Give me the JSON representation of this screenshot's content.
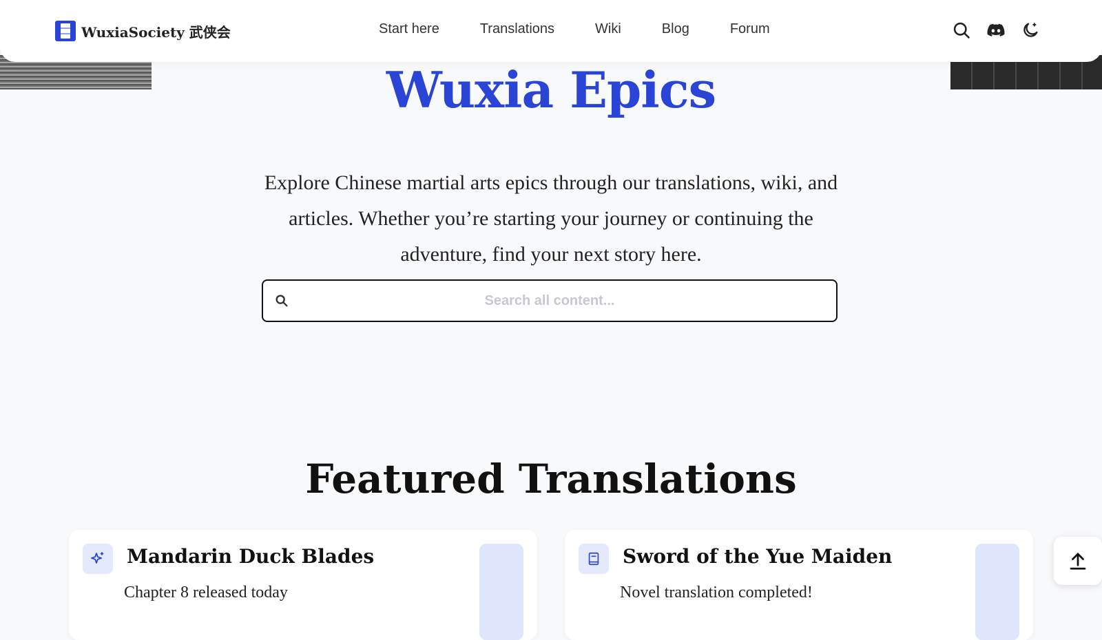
{
  "header": {
    "logo_text": "WuxiaSociety 武侠会",
    "nav": [
      "Start here",
      "Translations",
      "Wiki",
      "Blog",
      "Forum"
    ],
    "icons": [
      "search-icon",
      "discord-icon",
      "moon-icon"
    ]
  },
  "hero": {
    "title": "Wuxia Epics",
    "description": "Explore Chinese martial arts epics through our translations, wiki, and articles. Whether you’re starting your journey or continuing the adventure, find your next story here.",
    "search_placeholder": "Search all content..."
  },
  "featured": {
    "title": "Featured Translations",
    "cards": [
      {
        "title": "Mandarin Duck Blades",
        "subtitle": "Chapter 8 released today",
        "icon": "sparkle-icon"
      },
      {
        "title": "Sword of the Yue Maiden",
        "subtitle": "Novel translation completed!",
        "icon": "book-icon"
      }
    ]
  },
  "colors": {
    "accent": "#2a44d6",
    "background": "#f8f9fb",
    "card_icon_bg": "#e4e9fb"
  }
}
